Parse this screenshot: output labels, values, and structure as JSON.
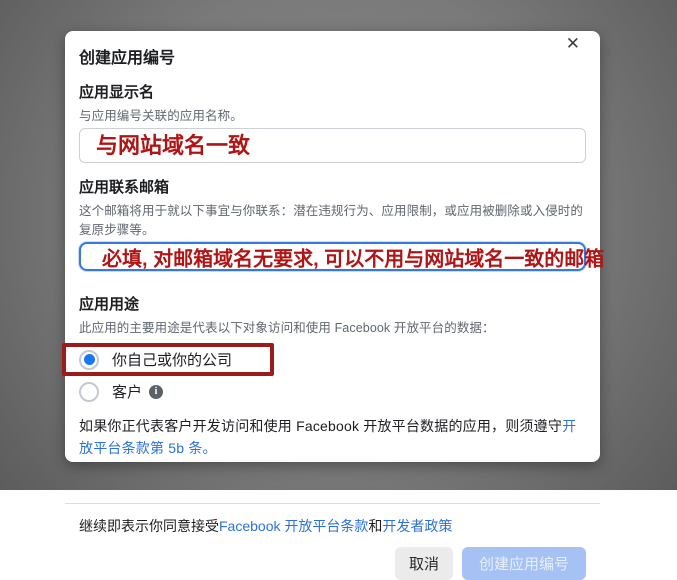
{
  "dialog": {
    "title": "创建应用编号",
    "fields": {
      "display_name": {
        "label": "应用显示名",
        "hint": "与应用编号关联的应用名称。",
        "annotation": "与网站域名一致"
      },
      "contact_email": {
        "label": "应用联系邮箱",
        "hint": "这个邮箱将用于就以下事宜与你联系：潜在违规行为、应用限制，或应用被删除或入侵时的复原步骤等。",
        "annotation": "必填, 对邮箱域名无要求, 可以不用与网站域名一致的邮箱"
      },
      "purpose": {
        "label": "应用用途",
        "hint": "此应用的主要用途是代表以下对象访问和使用 Facebook 开放平台的数据：",
        "options": [
          {
            "label": "你自己或你的公司",
            "selected": true
          },
          {
            "label": "客户",
            "selected": false
          }
        ]
      }
    },
    "client_note": {
      "text": "如果你正代表客户开发访问和使用 Facebook 开放平台数据的应用，则须遵守",
      "link": "开放平台条款第 5b 条。"
    },
    "footer": {
      "agreement_prefix": "继续即表示你同意接受",
      "terms_link": "Facebook 开放平台条款",
      "conjunction": "和",
      "policy_link": "开发者政策",
      "cancel_label": "取消",
      "create_label": "创建应用编号"
    }
  },
  "icons": {
    "close": "✕",
    "info": "i"
  },
  "colors": {
    "backdrop_gray": "#7a7a7a",
    "radio_accent_blue": "#1877f2",
    "focus_border_blue": "#3578e5",
    "link_blue": "#2b72d9",
    "annotation_red_text": "#b01414",
    "annotation_red_box": "#9e1b1b",
    "disabled_button_bg": "#a6c1f4",
    "cancel_button_bg": "#ebebeb"
  }
}
